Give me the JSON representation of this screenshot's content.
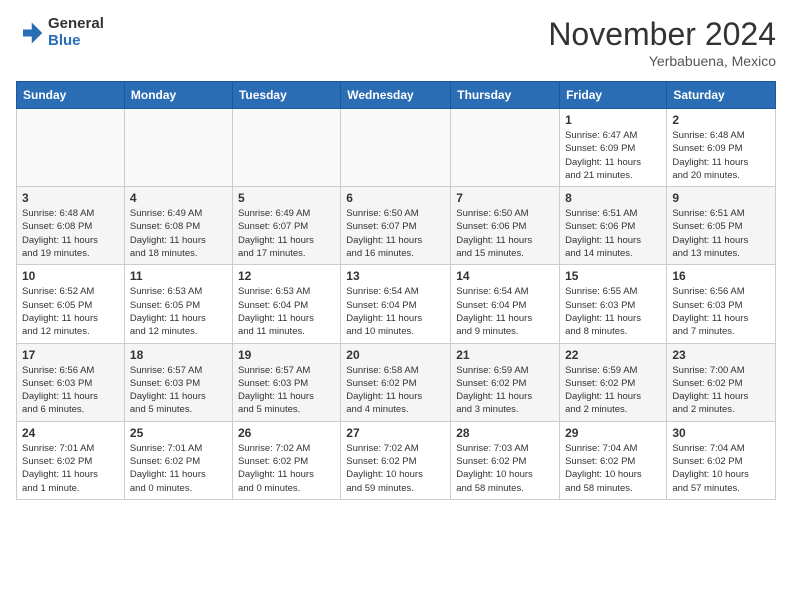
{
  "header": {
    "logo_general": "General",
    "logo_blue": "Blue",
    "month_title": "November 2024",
    "location": "Yerbabuena, Mexico"
  },
  "calendar": {
    "days_of_week": [
      "Sunday",
      "Monday",
      "Tuesday",
      "Wednesday",
      "Thursday",
      "Friday",
      "Saturday"
    ],
    "weeks": [
      [
        {
          "day": "",
          "info": "",
          "empty": true
        },
        {
          "day": "",
          "info": "",
          "empty": true
        },
        {
          "day": "",
          "info": "",
          "empty": true
        },
        {
          "day": "",
          "info": "",
          "empty": true
        },
        {
          "day": "",
          "info": "",
          "empty": true
        },
        {
          "day": "1",
          "info": "Sunrise: 6:47 AM\nSunset: 6:09 PM\nDaylight: 11 hours\nand 21 minutes."
        },
        {
          "day": "2",
          "info": "Sunrise: 6:48 AM\nSunset: 6:09 PM\nDaylight: 11 hours\nand 20 minutes."
        }
      ],
      [
        {
          "day": "3",
          "info": "Sunrise: 6:48 AM\nSunset: 6:08 PM\nDaylight: 11 hours\nand 19 minutes."
        },
        {
          "day": "4",
          "info": "Sunrise: 6:49 AM\nSunset: 6:08 PM\nDaylight: 11 hours\nand 18 minutes."
        },
        {
          "day": "5",
          "info": "Sunrise: 6:49 AM\nSunset: 6:07 PM\nDaylight: 11 hours\nand 17 minutes."
        },
        {
          "day": "6",
          "info": "Sunrise: 6:50 AM\nSunset: 6:07 PM\nDaylight: 11 hours\nand 16 minutes."
        },
        {
          "day": "7",
          "info": "Sunrise: 6:50 AM\nSunset: 6:06 PM\nDaylight: 11 hours\nand 15 minutes."
        },
        {
          "day": "8",
          "info": "Sunrise: 6:51 AM\nSunset: 6:06 PM\nDaylight: 11 hours\nand 14 minutes."
        },
        {
          "day": "9",
          "info": "Sunrise: 6:51 AM\nSunset: 6:05 PM\nDaylight: 11 hours\nand 13 minutes."
        }
      ],
      [
        {
          "day": "10",
          "info": "Sunrise: 6:52 AM\nSunset: 6:05 PM\nDaylight: 11 hours\nand 12 minutes."
        },
        {
          "day": "11",
          "info": "Sunrise: 6:53 AM\nSunset: 6:05 PM\nDaylight: 11 hours\nand 12 minutes."
        },
        {
          "day": "12",
          "info": "Sunrise: 6:53 AM\nSunset: 6:04 PM\nDaylight: 11 hours\nand 11 minutes."
        },
        {
          "day": "13",
          "info": "Sunrise: 6:54 AM\nSunset: 6:04 PM\nDaylight: 11 hours\nand 10 minutes."
        },
        {
          "day": "14",
          "info": "Sunrise: 6:54 AM\nSunset: 6:04 PM\nDaylight: 11 hours\nand 9 minutes."
        },
        {
          "day": "15",
          "info": "Sunrise: 6:55 AM\nSunset: 6:03 PM\nDaylight: 11 hours\nand 8 minutes."
        },
        {
          "day": "16",
          "info": "Sunrise: 6:56 AM\nSunset: 6:03 PM\nDaylight: 11 hours\nand 7 minutes."
        }
      ],
      [
        {
          "day": "17",
          "info": "Sunrise: 6:56 AM\nSunset: 6:03 PM\nDaylight: 11 hours\nand 6 minutes."
        },
        {
          "day": "18",
          "info": "Sunrise: 6:57 AM\nSunset: 6:03 PM\nDaylight: 11 hours\nand 5 minutes."
        },
        {
          "day": "19",
          "info": "Sunrise: 6:57 AM\nSunset: 6:03 PM\nDaylight: 11 hours\nand 5 minutes."
        },
        {
          "day": "20",
          "info": "Sunrise: 6:58 AM\nSunset: 6:02 PM\nDaylight: 11 hours\nand 4 minutes."
        },
        {
          "day": "21",
          "info": "Sunrise: 6:59 AM\nSunset: 6:02 PM\nDaylight: 11 hours\nand 3 minutes."
        },
        {
          "day": "22",
          "info": "Sunrise: 6:59 AM\nSunset: 6:02 PM\nDaylight: 11 hours\nand 2 minutes."
        },
        {
          "day": "23",
          "info": "Sunrise: 7:00 AM\nSunset: 6:02 PM\nDaylight: 11 hours\nand 2 minutes."
        }
      ],
      [
        {
          "day": "24",
          "info": "Sunrise: 7:01 AM\nSunset: 6:02 PM\nDaylight: 11 hours\nand 1 minute."
        },
        {
          "day": "25",
          "info": "Sunrise: 7:01 AM\nSunset: 6:02 PM\nDaylight: 11 hours\nand 0 minutes."
        },
        {
          "day": "26",
          "info": "Sunrise: 7:02 AM\nSunset: 6:02 PM\nDaylight: 11 hours\nand 0 minutes."
        },
        {
          "day": "27",
          "info": "Sunrise: 7:02 AM\nSunset: 6:02 PM\nDaylight: 10 hours\nand 59 minutes."
        },
        {
          "day": "28",
          "info": "Sunrise: 7:03 AM\nSunset: 6:02 PM\nDaylight: 10 hours\nand 58 minutes."
        },
        {
          "day": "29",
          "info": "Sunrise: 7:04 AM\nSunset: 6:02 PM\nDaylight: 10 hours\nand 58 minutes."
        },
        {
          "day": "30",
          "info": "Sunrise: 7:04 AM\nSunset: 6:02 PM\nDaylight: 10 hours\nand 57 minutes."
        }
      ]
    ]
  }
}
